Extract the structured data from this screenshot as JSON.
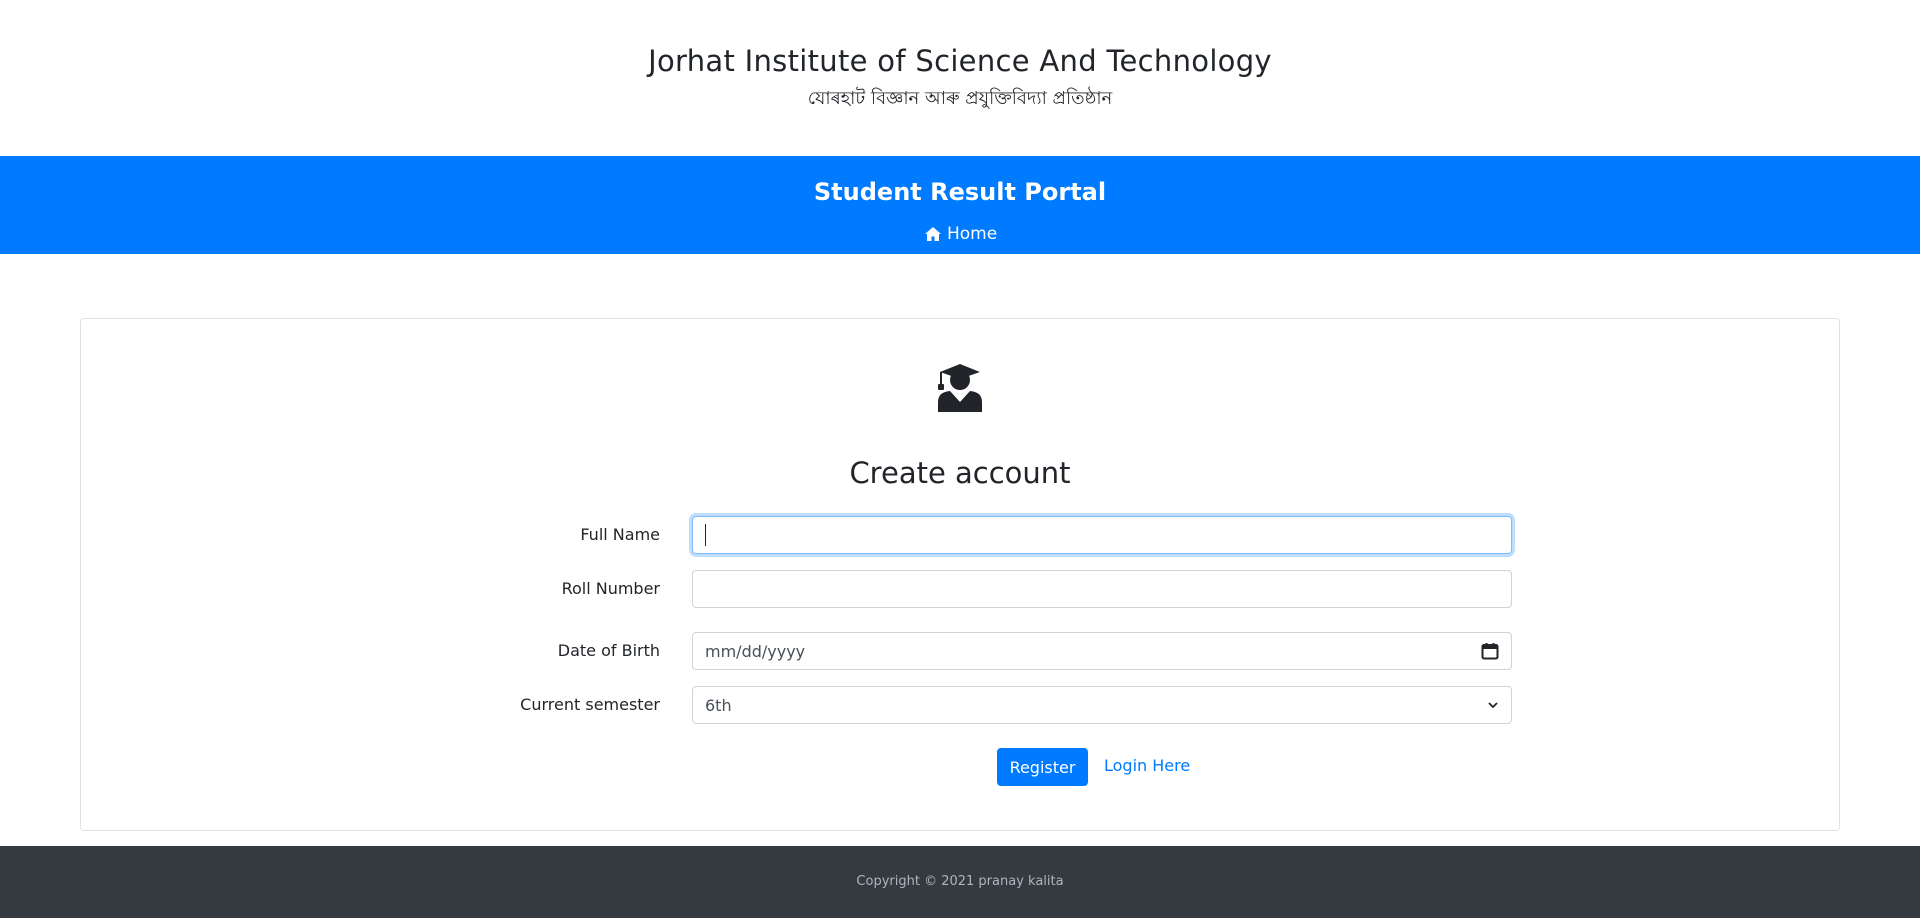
{
  "header": {
    "title": "Jorhat Institute of Science And Technology",
    "subtitle": "যোৰহাট বিজ্ঞান আৰু প্ৰযুক্তিবিদ্যা প্ৰতিষ্ঠান"
  },
  "nav": {
    "portal_title": "Student Result Portal",
    "home_label": "Home",
    "home_icon": "home-icon"
  },
  "form": {
    "icon": "graduate-student-icon",
    "title": "Create account",
    "fields": {
      "full_name": {
        "label": "Full Name",
        "value": ""
      },
      "roll_number": {
        "label": "Roll Number",
        "value": ""
      },
      "dob": {
        "label": "Date of Birth",
        "placeholder": "mm/dd/yyyy",
        "icon": "calendar-icon"
      },
      "semester": {
        "label": "Current semester",
        "selected": "6th",
        "icon": "chevron-down-icon"
      }
    },
    "register_label": "Register",
    "login_label": "Login Here"
  },
  "footer": {
    "copyright": "Copyright © 2021 pranay kalita"
  },
  "colors": {
    "primary": "#007bff",
    "footer_bg": "#343a40",
    "text": "#212529"
  }
}
